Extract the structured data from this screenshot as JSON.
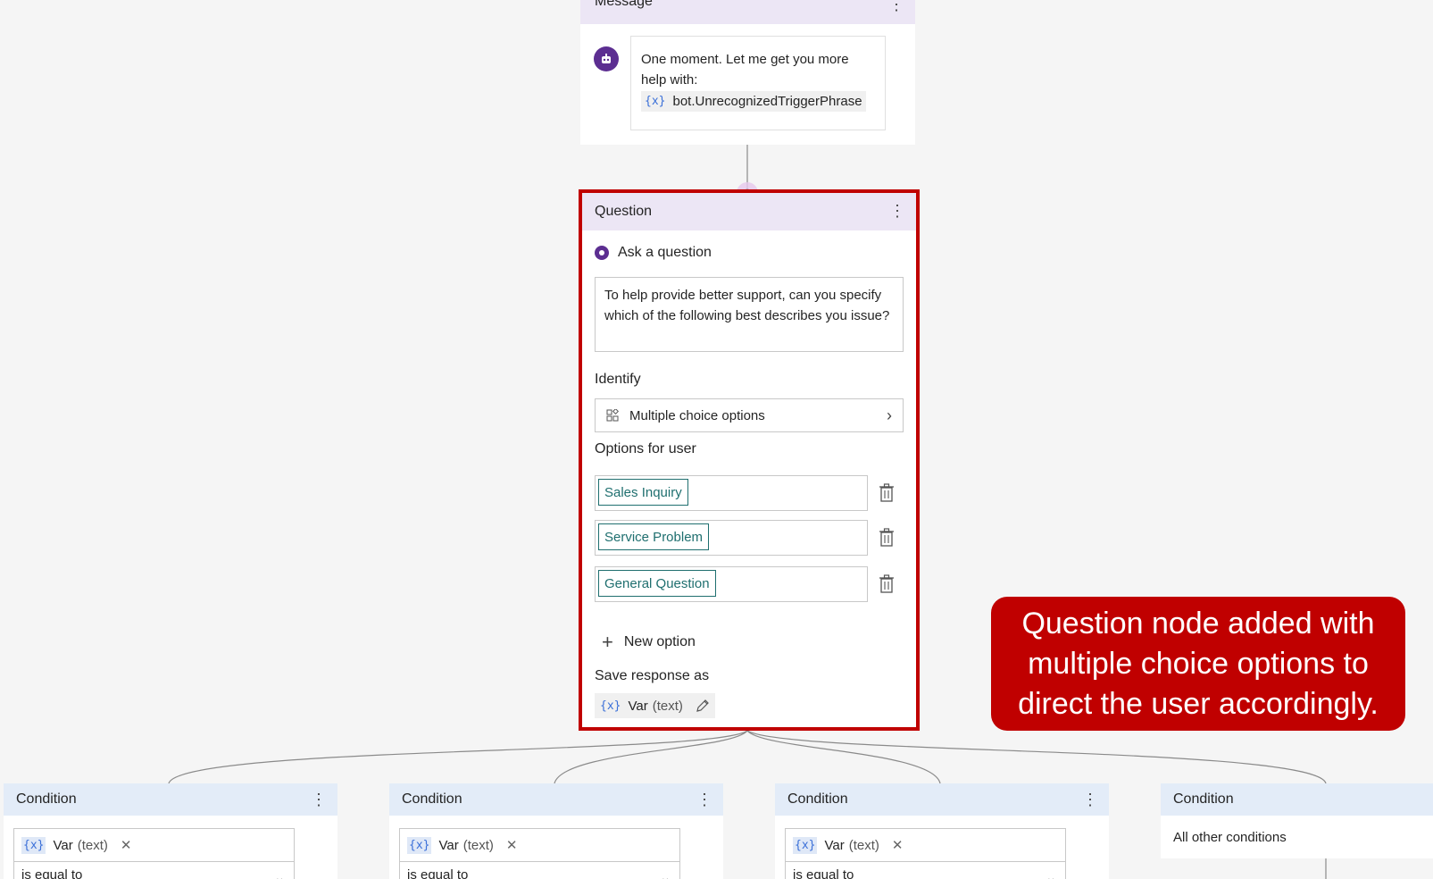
{
  "message_node": {
    "title": "Message",
    "text": "One moment. Let me get you more help with:",
    "variable_token": "{x}",
    "variable": "bot.UnrecognizedTriggerPhrase"
  },
  "question_node": {
    "title": "Question",
    "ask_label": "Ask a question",
    "question_text": "To help provide better support, can you specify which of the following best describes you issue?",
    "identify_label": "Identify",
    "identify_value": "Multiple choice options",
    "options_label": "Options for user",
    "options": [
      "Sales Inquiry",
      "Service Problem",
      "General Question"
    ],
    "new_option_label": "New option",
    "save_label": "Save response as",
    "save_variable_token": "{x}",
    "save_variable_name": "Var",
    "save_variable_type": "(text)"
  },
  "callout": {
    "text": "Question node added with multiple choice options to direct the user accordingly."
  },
  "conditions": [
    {
      "title": "Condition",
      "var_token": "{x}",
      "var_name": "Var",
      "var_type": "(text)",
      "operator": "is equal to"
    },
    {
      "title": "Condition",
      "var_token": "{x}",
      "var_name": "Var",
      "var_type": "(text)",
      "operator": "is equal to"
    },
    {
      "title": "Condition",
      "var_token": "{x}",
      "var_name": "Var",
      "var_type": "(text)",
      "operator": "is equal to"
    },
    {
      "title": "Condition",
      "other_text": "All other conditions"
    }
  ],
  "colors": {
    "highlight": "#c00000",
    "node_header_purple": "#ece6f5",
    "condition_header_blue": "#e3ecf8",
    "bot_icon": "#5c2e91",
    "option_chip": "#1f6f6f"
  }
}
